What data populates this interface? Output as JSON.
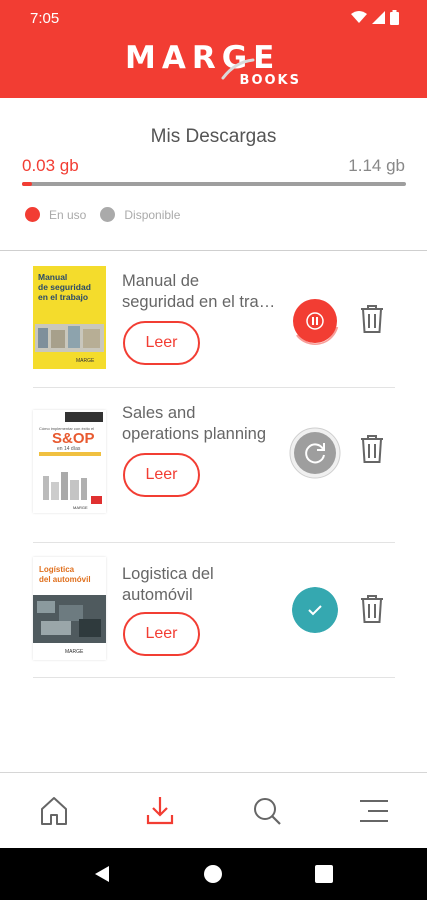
{
  "status_bar": {
    "time": "7:05"
  },
  "header": {
    "logo_main": "MARGE",
    "logo_sub": "BOOKS"
  },
  "storage": {
    "title": "Mis Descargas",
    "used": "0.03 gb",
    "total": "1.14 gb",
    "used_fraction": 0.026,
    "legend": {
      "used_label": "En uso",
      "available_label": "Disponible"
    }
  },
  "books": [
    {
      "title_line1": "Manual de",
      "title_line2": "seguridad en el trabajo",
      "read_label": "Leer",
      "status": "downloading-paused",
      "cover": {
        "line1": "Manual",
        "line2": "de seguridad",
        "line3": "en el trabajo",
        "publisher": "MARGE"
      }
    },
    {
      "title_line1": "Sales and",
      "title_line2": "operations planning",
      "read_label": "Leer",
      "status": "pending",
      "cover": {
        "line1": "Cómo implementar con éxito el",
        "line2": "S&OP",
        "line3": "en 14 días",
        "publisher": "MARGE"
      }
    },
    {
      "title_line1": "Logistica del",
      "title_line2": "automóvil",
      "read_label": "Leer",
      "status": "downloaded",
      "cover": {
        "line1": "Logística",
        "line2": "del automóvil",
        "publisher": "MARGE"
      }
    }
  ],
  "colors": {
    "brand": "#f23d33",
    "teal": "#35a8b0",
    "gray": "#9e9e9e"
  },
  "nav": {
    "items": [
      "home-icon",
      "download-icon",
      "search-icon",
      "menu-icon"
    ],
    "active": "download-icon"
  }
}
